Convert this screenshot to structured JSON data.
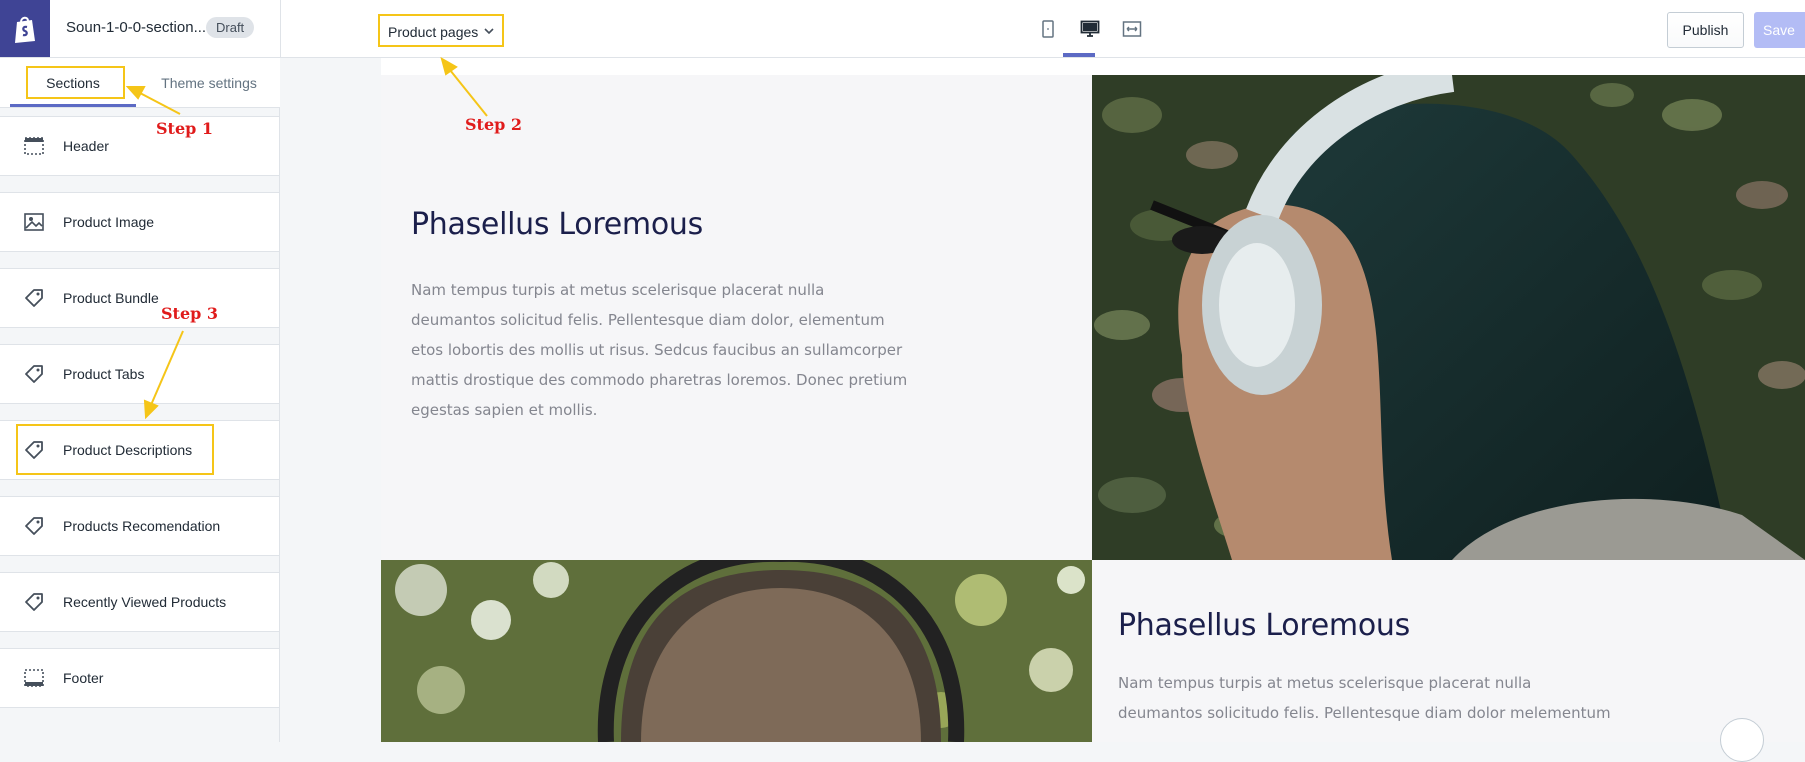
{
  "topbar": {
    "theme_name": "Soun-1-0-0-section...",
    "status_badge": "Draft",
    "page_selector": "Product pages",
    "devices": [
      "mobile-icon",
      "desktop-icon",
      "full-width-icon"
    ],
    "publish_label": "Publish",
    "save_label": "Save"
  },
  "sidebar": {
    "tabs": [
      {
        "label": "Sections",
        "active": true
      },
      {
        "label": "Theme settings",
        "active": false
      }
    ],
    "items": [
      {
        "label": "Header",
        "icon": "header-layout-icon"
      },
      {
        "label": "Product Image",
        "icon": "image-icon"
      },
      {
        "label": "Product Bundle",
        "icon": "tag-icon"
      },
      {
        "label": "Product Tabs",
        "icon": "tag-icon"
      },
      {
        "label": "Product Descriptions",
        "icon": "tag-icon"
      },
      {
        "label": "Products Recomendation",
        "icon": "tag-icon"
      },
      {
        "label": "Recently Viewed Products",
        "icon": "tag-icon"
      },
      {
        "label": "Footer",
        "icon": "footer-layout-icon"
      }
    ]
  },
  "preview": {
    "block1": {
      "heading": "Phasellus Loremous",
      "lines": [
        "Nam tempus turpis at metus scelerisque placerat nulla",
        "deumantos solicitud felis. Pellentesque diam dolor, elementum",
        "etos lobortis des mollis ut risus. Sedcus faucibus an sullamcorper",
        "mattis drostique des commodo pharetras loremos. Donec pretium",
        "egestas sapien et mollis."
      ]
    },
    "block2": {
      "heading": "Phasellus Loremous",
      "lines": [
        "Nam tempus turpis at metus scelerisque placerat nulla",
        "deumantos solicitudo felis. Pellentesque diam dolor melementum"
      ]
    }
  },
  "annotations": {
    "step1": "Step 1",
    "step2": "Step 2",
    "step3": "Step 3",
    "color": "#f5c518",
    "text_color": "#e01b1b"
  },
  "colors": {
    "accent": "#5c6ac4",
    "logo_bg": "#3f4495",
    "heading": "#1b1f4b"
  }
}
